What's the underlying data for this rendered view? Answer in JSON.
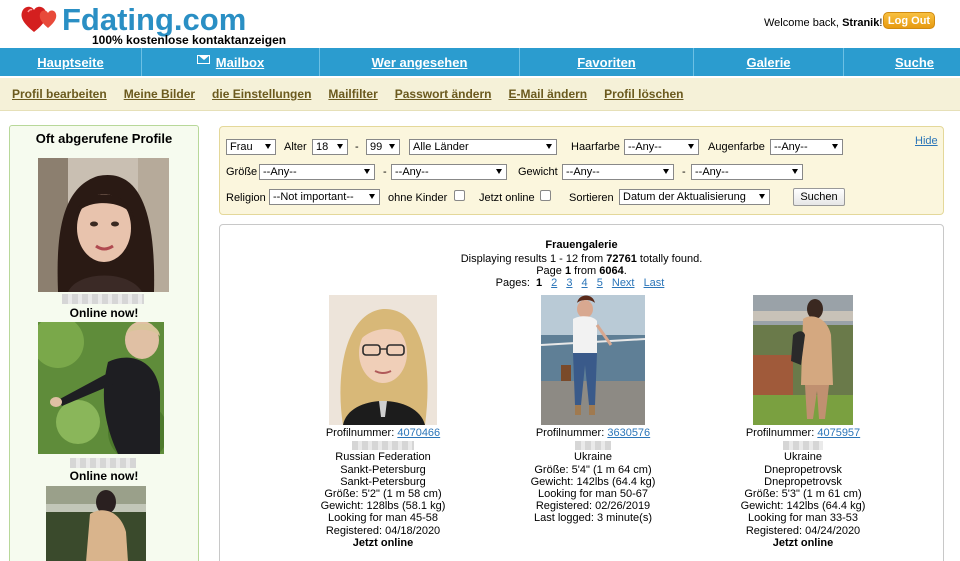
{
  "header": {
    "logo_text": "Fdating.com",
    "tagline": "100% kostenlose kontaktanzeigen",
    "welcome_prefix": "Welcome back,",
    "username": "Stranik",
    "welcome_suffix": "!",
    "logout_label": "Log Out",
    "flag_colors": [
      "#c8102e",
      "#ffffff",
      "#002a8f",
      "#ffce00",
      "#008751",
      "#ff9933",
      "#0038a8",
      "#d52b1e",
      "#009b3a",
      "#ce1126",
      "#000000",
      "#ffd700"
    ]
  },
  "main_nav": {
    "items": [
      {
        "label": "Hauptseite",
        "icon": ""
      },
      {
        "label": "Mailbox",
        "icon": "mail-icon"
      },
      {
        "label": "Wer angesehen",
        "icon": ""
      },
      {
        "label": "Favoriten",
        "icon": ""
      },
      {
        "label": "Galerie",
        "icon": ""
      },
      {
        "label": "Suche",
        "icon": ""
      }
    ]
  },
  "sub_nav": {
    "items": [
      "Profil bearbeiten",
      "Meine Bilder",
      "die Einstellungen",
      "Mailfilter",
      "Passwort ändern",
      "E-Mail ändern",
      "Profil löschen"
    ]
  },
  "sidebar": {
    "title": "Oft abgerufene Profile",
    "profiles": [
      {
        "status": "Online now!"
      },
      {
        "status": "Online now!"
      },
      {
        "status": ""
      }
    ]
  },
  "filter": {
    "gender": "Frau",
    "age_label": "Alter",
    "age_from": "18",
    "age_sep": "-",
    "age_to": "99",
    "country": "Alle Länder",
    "hair_label": "Haarfarbe",
    "hair_value": "--Any--",
    "eye_label": "Augenfarbe",
    "eye_value": "--Any--",
    "height_label": "Größe",
    "height_from": "--Any--",
    "height_sep": "-",
    "height_to": "--Any--",
    "weight_label": "Gewicht",
    "weight_from": "--Any--",
    "weight_sep": "-",
    "weight_to": "--Any--",
    "religion_label": "Religion",
    "religion_value": "--Not important--",
    "no_kids_label": "ohne Kinder",
    "online_label": "Jetzt online",
    "sort_label": "Sortieren",
    "sort_value": "Datum der Aktualisierung",
    "search_button": "Suchen",
    "hide_link": "Hide"
  },
  "gallery": {
    "title": "Frauengalerie",
    "results_prefix": "Displaying results 1 - 12 from",
    "results_total": "72761",
    "results_suffix": "totally found.",
    "page_prefix": "Page",
    "page_current": "1",
    "page_from": "from",
    "page_total": "6064",
    "page_suffix": ".",
    "pages_label": "Pages:",
    "pages": [
      "1",
      "2",
      "3",
      "4",
      "5"
    ],
    "next_label": "Next",
    "last_label": "Last",
    "profile_label": "Profilnummer:",
    "cards": [
      {
        "id": "4070466",
        "lines": [
          "Russian Federation",
          "Sankt-Petersburg",
          "Sankt-Petersburg",
          "Größe: 5'2\" (1 m 58 cm)",
          "Gewicht: 128lbs (58.1 kg)",
          "Looking for man 45-58",
          "Registered: 04/18/2020"
        ],
        "status": "Jetzt online"
      },
      {
        "id": "3630576",
        "lines": [
          "Ukraine",
          "Größe: 5'4\" (1 m 64 cm)",
          "Gewicht: 142lbs (64.4 kg)",
          "Looking for man 50-67",
          "Registered: 02/26/2019",
          "Last logged: 3 minute(s)"
        ],
        "status": ""
      },
      {
        "id": "4075957",
        "lines": [
          "Ukraine",
          "Dnepropetrovsk",
          "Dnepropetrovsk",
          "Größe: 5'3\" (1 m 61 cm)",
          "Gewicht: 142lbs (64.4 kg)",
          "Looking for man 33-53",
          "Registered: 04/24/2020"
        ],
        "status": "Jetzt online"
      }
    ]
  }
}
